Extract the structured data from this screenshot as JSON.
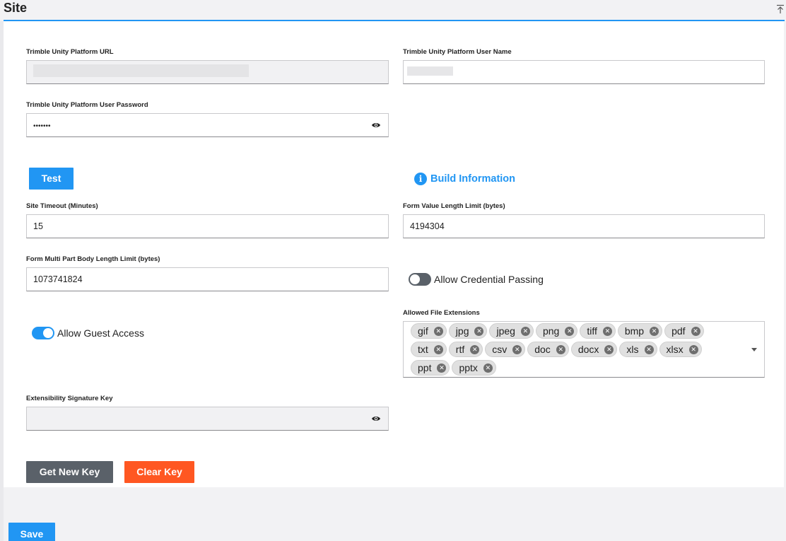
{
  "header": {
    "title": "Site"
  },
  "fields": {
    "platform_url": {
      "label": "Trimble Unity Platform URL",
      "value": ""
    },
    "platform_user": {
      "label": "Trimble Unity Platform User Name",
      "value": ""
    },
    "platform_password": {
      "label": "Trimble Unity Platform User Password",
      "value": "•••••••"
    },
    "site_timeout": {
      "label": "Site Timeout (Minutes)",
      "value": "15"
    },
    "form_value_limit": {
      "label": "Form Value Length Limit (bytes)",
      "value": "4194304"
    },
    "multipart_limit": {
      "label": "Form Multi Part Body Length Limit (bytes)",
      "value": "1073741824"
    },
    "signature_key": {
      "label": "Extensibility Signature Key",
      "value": ""
    }
  },
  "buttons": {
    "test": "Test",
    "build_info": "Build Information",
    "get_new_key": "Get New Key",
    "clear_key": "Clear Key",
    "save": "Save"
  },
  "toggles": {
    "credential_passing": {
      "label": "Allow Credential Passing",
      "on": false
    },
    "guest_access": {
      "label": "Allow Guest Access",
      "on": true
    }
  },
  "extensions": {
    "label": "Allowed File Extensions",
    "chips": [
      "gif",
      "jpg",
      "jpeg",
      "png",
      "tiff",
      "bmp",
      "pdf",
      "txt",
      "rtf",
      "csv",
      "doc",
      "docx",
      "xls",
      "xlsx",
      "ppt",
      "pptx"
    ]
  },
  "icons": {
    "info": "info-icon",
    "eye": "eye-icon",
    "collapse": "collapse-top-icon",
    "dropdown": "chevron-down-icon",
    "chip_remove": "remove-chip-icon"
  },
  "colors": {
    "accent": "#2196f3",
    "danger": "#ff5722",
    "neutral_button": "#5a6169"
  }
}
